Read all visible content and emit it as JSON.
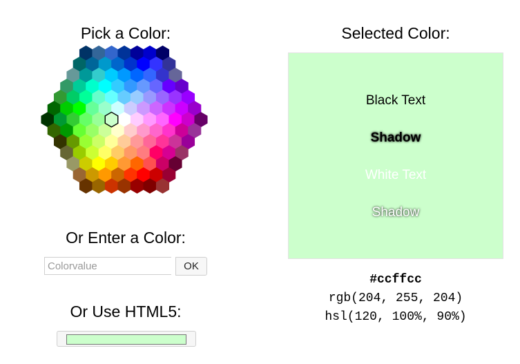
{
  "headings": {
    "pick": "Pick a Color:",
    "enter": "Or Enter a Color:",
    "html5": "Or Use HTML5:",
    "selected": "Selected Color:"
  },
  "input": {
    "placeholder": "Colorvalue",
    "value": "",
    "button_label": "OK"
  },
  "html5_picker": {
    "value": "#ccffcc"
  },
  "selected": {
    "color": "#ccffcc",
    "samples": {
      "black_text": "Black Text",
      "shadow_dark": "Shadow",
      "white_text": "White Text",
      "shadow_light": "Shadow"
    },
    "hex": "#ccffcc",
    "rgb": "rgb(204, 255, 204)",
    "hsl": "hsl(120, 100%, 90%)"
  },
  "color_map": {
    "selected_cell": "#ccffcc",
    "rows": [
      [
        "#003366",
        "#336699",
        "#3366CC",
        "#003399",
        "#000099",
        "#0000CC",
        "#000066"
      ],
      [
        "#006666",
        "#006699",
        "#0099CC",
        "#0066CC",
        "#0033CC",
        "#0000FF",
        "#3333FF",
        "#333399"
      ],
      [
        "#669999",
        "#009999",
        "#33CCCC",
        "#00CCFF",
        "#0099FF",
        "#0066FF",
        "#3366FF",
        "#3333CC",
        "#666699"
      ],
      [
        "#339966",
        "#00CC99",
        "#00FFCC",
        "#00FFFF",
        "#33CCFF",
        "#3399FF",
        "#6699FF",
        "#6666FF",
        "#6600FF",
        "#6600CC"
      ],
      [
        "#339933",
        "#00CC66",
        "#00FF99",
        "#66FFCC",
        "#66FFFF",
        "#66CCFF",
        "#99CCFF",
        "#9999FF",
        "#9966FF",
        "#9933FF",
        "#9900FF"
      ],
      [
        "#006600",
        "#00CC00",
        "#00FF00",
        "#66FF99",
        "#99FFCC",
        "#CCFFFF",
        "#CCCCFF",
        "#CC99FF",
        "#CC66FF",
        "#CC33FF",
        "#CC00FF",
        "#9900CC"
      ],
      [
        "#003300",
        "#009933",
        "#33CC33",
        "#66FF66",
        "#99FF99",
        "#CCFFCC",
        "#FFFFFF",
        "#FFCCFF",
        "#FF99FF",
        "#FF66FF",
        "#FF00FF",
        "#CC00CC",
        "#660066"
      ],
      [
        "#336600",
        "#009900",
        "#66FF33",
        "#99FF66",
        "#CCFF99",
        "#FFFFCC",
        "#FFCCCC",
        "#FF99CC",
        "#FF66CC",
        "#FF33CC",
        "#CC0099",
        "#993399"
      ],
      [
        "#333300",
        "#669900",
        "#99FF33",
        "#CCFF66",
        "#FFFF99",
        "#FFCC99",
        "#FF9999",
        "#FF6699",
        "#FF3399",
        "#CC3399",
        "#990099"
      ],
      [
        "#666633",
        "#99CC00",
        "#CCFF33",
        "#FFFF66",
        "#FFCC66",
        "#FF9966",
        "#FF7C80",
        "#FF0066",
        "#D60093",
        "#993366"
      ],
      [
        "#999966",
        "#CCCC00",
        "#FFFF00",
        "#FFCC00",
        "#FF9933",
        "#FF6600",
        "#FF5050",
        "#CC0066",
        "#660033"
      ],
      [
        "#996633",
        "#CC9900",
        "#FF9900",
        "#CC6600",
        "#FF3300",
        "#FF0000",
        "#CC0000",
        "#990033"
      ],
      [
        "#663300",
        "#996600",
        "#CC3300",
        "#993300",
        "#990000",
        "#800000",
        "#993333"
      ]
    ]
  }
}
